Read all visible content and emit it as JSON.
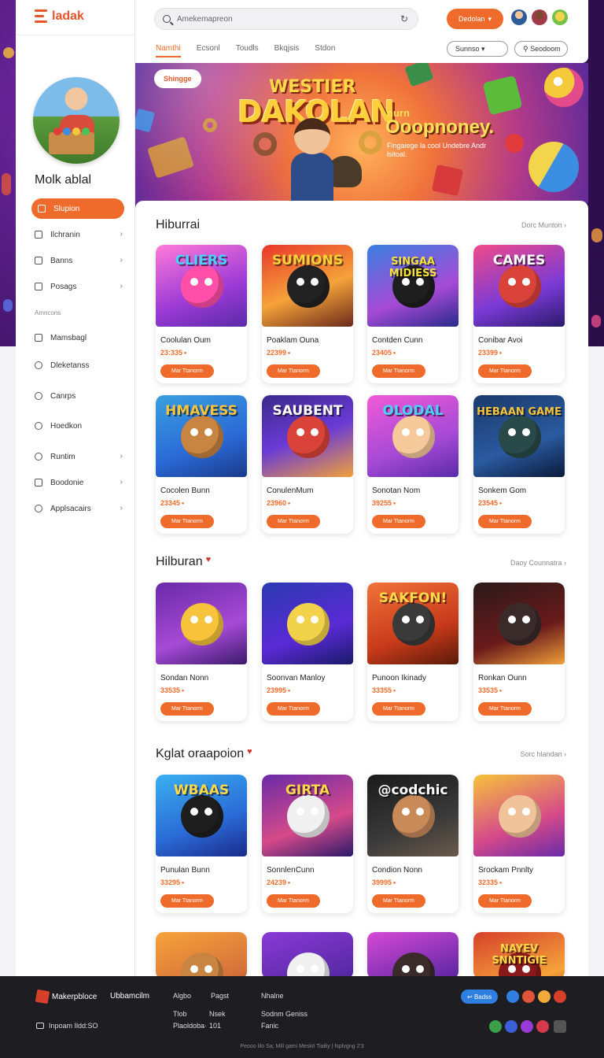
{
  "app": {
    "logo_text": "ladak"
  },
  "header": {
    "search_placeholder": "Amekemapreon",
    "primary_button": "Dedolan",
    "tabs": [
      "Namthi",
      "Ecsonl",
      "Toudls",
      "Bkqjsis",
      "Stdon"
    ],
    "select_1": "Sunnso",
    "select_2": "Seodoom"
  },
  "sidebar": {
    "username": "Molk ablal",
    "items": [
      {
        "label": "Slupion",
        "active": true
      },
      {
        "label": "Ilchranin"
      },
      {
        "label": "Banns"
      },
      {
        "label": "Posags"
      }
    ],
    "section_label": "Amncons",
    "items2": [
      {
        "label": "Mamsbagl"
      },
      {
        "label": "Dleketanss"
      },
      {
        "label": "Canrps"
      },
      {
        "label": "Hoedkon"
      },
      {
        "label": "Runtim"
      },
      {
        "label": "Boodonie"
      },
      {
        "label": "Applsacairs"
      }
    ]
  },
  "banner": {
    "chip": "Shingge",
    "title_top": "WESTIER",
    "title_main": "DAKOLAN",
    "side_small": "nurn",
    "side_big": "Ooopnoney.",
    "side_text": "Fingaiege la cool Undebre Andr lsitoal."
  },
  "sections": [
    {
      "title": "Hiburrai",
      "heart": false,
      "see_all": "Dorc Munton",
      "cards": [
        {
          "name": "Coolulan Oum",
          "count": "23:335",
          "art": "CLIERS"
        },
        {
          "name": "Poaklam Ouna",
          "count": "22399",
          "art": "SUMIONS"
        },
        {
          "name": "Contden Cunn",
          "count": "23405",
          "art": "SINGAA MIDIESS"
        },
        {
          "name": "Conibar Avoi",
          "count": "23399",
          "art": "CAMES"
        },
        {
          "name": "Cocolen Bunn",
          "count": "23345",
          "art": "HMAVESS"
        },
        {
          "name": "ConulenMum",
          "count": "23960",
          "art": "SAUBENT"
        },
        {
          "name": "Sonotan Nom",
          "count": "39255",
          "art": "OLODAL"
        },
        {
          "name": "Sonkem Gom",
          "count": "23545",
          "art": "HEBAAN GAME"
        }
      ]
    },
    {
      "title": "Hilburan",
      "heart": true,
      "see_all": "Daoy Counnatra",
      "cards": [
        {
          "name": "Sondan Nonn",
          "count": "33535",
          "art": ""
        },
        {
          "name": "Soonvan Manloy",
          "count": "23995",
          "art": ""
        },
        {
          "name": "Punoon Ikinady",
          "count": "33355",
          "art": "SAKFON!"
        },
        {
          "name": "Ronkan Ounn",
          "count": "33535",
          "art": ""
        }
      ]
    },
    {
      "title": "Kglat oraapoion",
      "heart": true,
      "see_all": "Sorc hlandan",
      "cards": [
        {
          "name": "Punulan Bunn",
          "count": "33295",
          "art": "WBAAS"
        },
        {
          "name": "SonnlenCunn",
          "count": "24239",
          "art": "GIRTA"
        },
        {
          "name": "Condion Nonn",
          "count": "39995",
          "art": "@codchic"
        },
        {
          "name": "Srockam Pnnlty",
          "count": "32335",
          "art": ""
        }
      ]
    }
  ],
  "row4_art": [
    "",
    "",
    "",
    "NAYEV SNNTIGIE"
  ],
  "card_button_label": "Mar Ttanorm",
  "footer": {
    "brand": "Makerpbloce",
    "col1": "Ubbamcilm",
    "col2_1": "Algbo",
    "col2_2": "Tlob",
    "col2_3": "Plaoldoba·",
    "col3_1": "Pagst",
    "col3_2": "Nsek",
    "col3_3": "101",
    "col4_1": "Nhalne",
    "col4_2": "Sodnm Geniss",
    "col4_3": "Fanic",
    "email_label": "Inpoam Ildd:SO",
    "badge": "Badss",
    "copyright": "Peooo lilo Sa; Mill gami Meskit Tiailiy | fsplvgng 2'3"
  }
}
